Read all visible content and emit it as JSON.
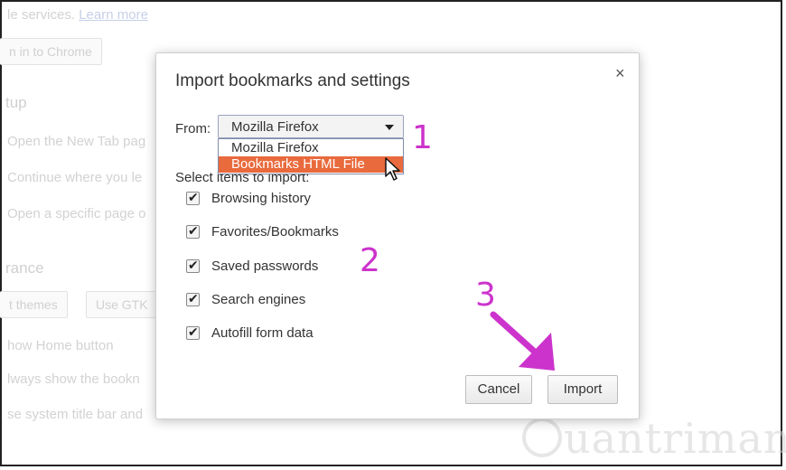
{
  "background": {
    "services_text": "le services.",
    "learn_more": "Learn more",
    "sign_in_button": "n in to Chrome",
    "startup_heading": "tup",
    "startup_opt1": "Open the New Tab pag",
    "startup_opt2": "Continue where you le",
    "startup_opt3": "Open a specific page o",
    "appearance_heading": "rance",
    "themes_button": "t themes",
    "gtk_button": "Use GTK",
    "show_home": "how Home button",
    "always_show": "lways show the bookn",
    "system_title": "se system title bar and"
  },
  "dialog": {
    "title": "Import bookmarks and settings",
    "close_glyph": "×",
    "from_label": "From:",
    "selected": "Mozilla Firefox",
    "options": [
      "Mozilla Firefox",
      "Bookmarks HTML File"
    ],
    "select_items_label": "Select items to import:",
    "items": [
      {
        "label": "Browsing history",
        "checked": true
      },
      {
        "label": "Favorites/Bookmarks",
        "checked": true
      },
      {
        "label": "Saved passwords",
        "checked": true
      },
      {
        "label": "Search engines",
        "checked": true
      },
      {
        "label": "Autofill form data",
        "checked": true
      }
    ],
    "checkmark_glyph": "✔",
    "cancel_label": "Cancel",
    "import_label": "Import"
  },
  "annotations": {
    "step1": "1",
    "step2": "2",
    "step3": "3",
    "color": "#cc33cc"
  },
  "watermark": {
    "text": "uantrimang"
  },
  "colors": {
    "highlight": "#e96a3c",
    "annotation": "#cc33cc"
  }
}
